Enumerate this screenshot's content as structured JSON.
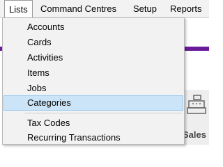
{
  "menubar": {
    "items": [
      {
        "label": "Lists"
      },
      {
        "label": "Command Centres"
      },
      {
        "label": "Setup"
      },
      {
        "label": "Reports"
      }
    ]
  },
  "background": {
    "sales_label": "Sales"
  },
  "lists_menu": {
    "items": [
      {
        "label": "Accounts"
      },
      {
        "label": "Cards"
      },
      {
        "label": "Activities"
      },
      {
        "label": "Items"
      },
      {
        "label": "Jobs"
      },
      {
        "label": "Categories"
      },
      {
        "label": "Tax Codes"
      },
      {
        "label": "Recurring Transactions"
      }
    ],
    "selected": "Categories"
  },
  "colors": {
    "accent_band": "#6a1b9a",
    "selection_bg": "#cce4f7",
    "selection_border": "#99c9ef"
  }
}
